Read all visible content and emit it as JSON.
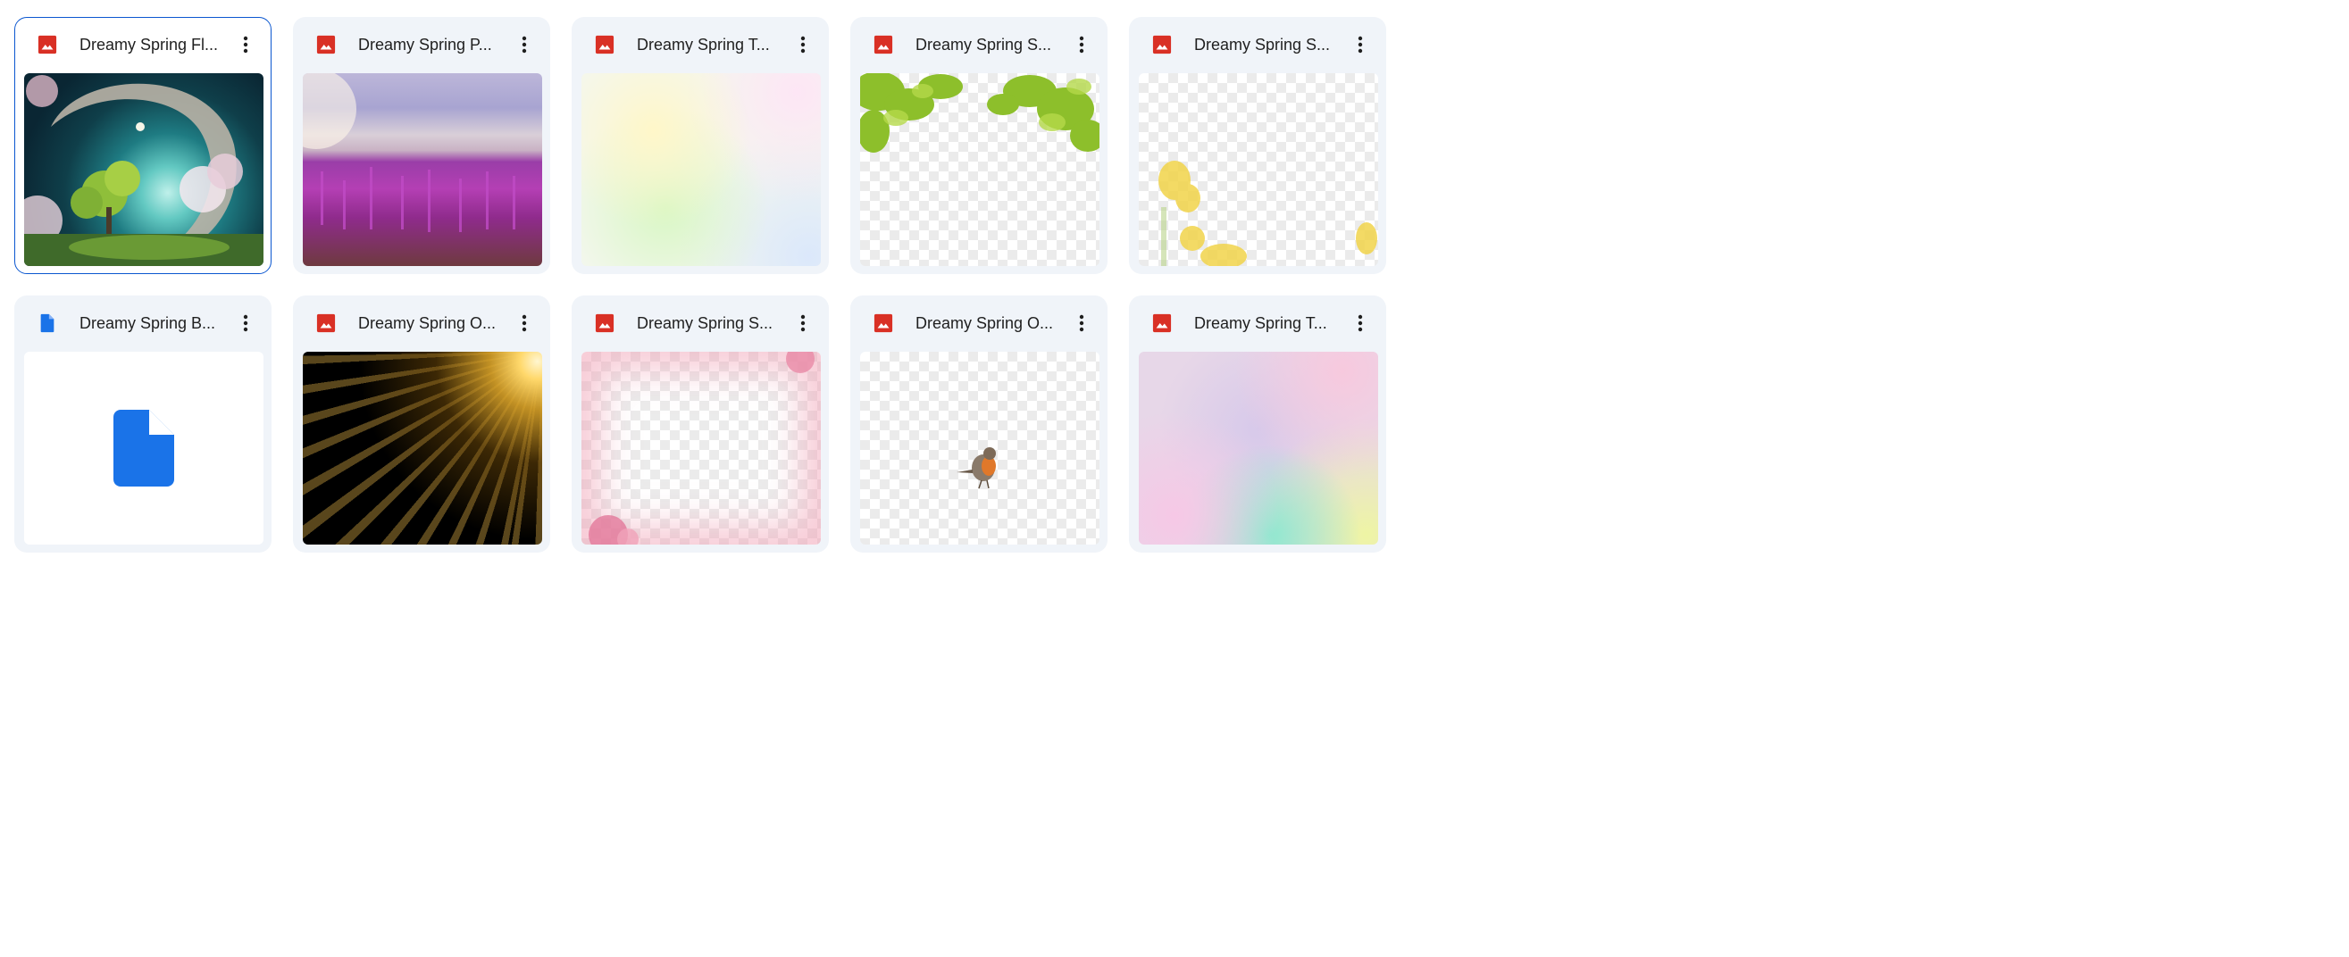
{
  "files": [
    {
      "title": "Dreamy Spring Fl...",
      "type": "image",
      "selected": true,
      "thumb_kind": "moon"
    },
    {
      "title": "Dreamy Spring P...",
      "type": "image",
      "selected": false,
      "thumb_kind": "field"
    },
    {
      "title": "Dreamy Spring T...",
      "type": "image",
      "selected": false,
      "thumb_kind": "pastel-green"
    },
    {
      "title": "Dreamy Spring S...",
      "type": "image",
      "selected": false,
      "thumb_kind": "leaves-transparent"
    },
    {
      "title": "Dreamy Spring S...",
      "type": "image",
      "selected": false,
      "thumb_kind": "yellow-flowers-transparent"
    },
    {
      "title": "Dreamy Spring B...",
      "type": "document",
      "selected": false,
      "thumb_kind": "blank-doc"
    },
    {
      "title": "Dreamy Spring O...",
      "type": "image",
      "selected": false,
      "thumb_kind": "sun-rays"
    },
    {
      "title": "Dreamy Spring S...",
      "type": "image",
      "selected": false,
      "thumb_kind": "pink-blossom-frame"
    },
    {
      "title": "Dreamy Spring O...",
      "type": "image",
      "selected": false,
      "thumb_kind": "robin-transparent"
    },
    {
      "title": "Dreamy Spring T...",
      "type": "image",
      "selected": false,
      "thumb_kind": "pastel-rainbow"
    }
  ],
  "icons": {
    "image_file": "image-file-icon",
    "document_file": "document-file-icon",
    "more": "more-vert-icon"
  },
  "colors": {
    "card_bg": "#f0f4f9",
    "selected_border": "#0b57d0",
    "image_icon": "#d93025",
    "doc_icon": "#1a73e8",
    "title_text": "#1f1f1f"
  }
}
